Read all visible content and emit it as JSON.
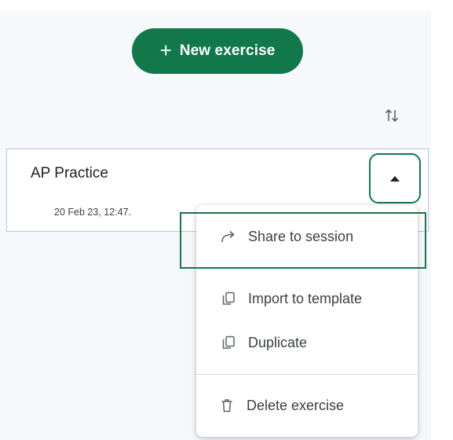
{
  "new_exercise_button": {
    "icon": "plus-icon",
    "label": "New exercise",
    "color": "#10784a"
  },
  "sort_icon": "sort-arrows-icon",
  "exercise": {
    "title": "AP Practice",
    "date": "20 Feb 23, 12:47.",
    "collapse_icon": "caret-up-icon"
  },
  "menu": {
    "items": [
      {
        "icon": "share-arrow-icon",
        "label": "Share to session",
        "highlighted": true
      },
      {
        "icon": "copy-icon",
        "label": "Import to template"
      },
      {
        "icon": "copy-icon",
        "label": "Duplicate"
      },
      {
        "icon": "trash-icon",
        "label": "Delete exercise"
      }
    ]
  },
  "colors": {
    "accent": "#10784a",
    "card_border": "#b7c6ea",
    "panel_bg": "#f6f8fb"
  }
}
